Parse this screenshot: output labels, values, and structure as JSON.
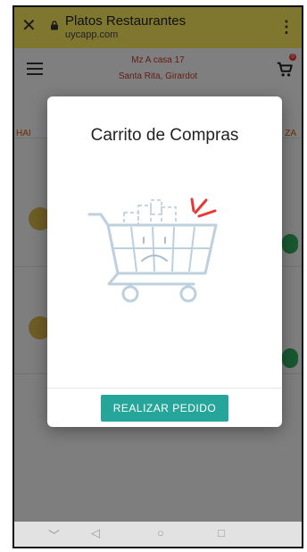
{
  "browser": {
    "title": "Platos Restaurantes",
    "url": "uycapp.com"
  },
  "header": {
    "address_line1": "Mz A casa 17",
    "address_line2": "Santa Rita, Girardot",
    "cart_count": "0"
  },
  "tabs": {
    "left_partial": "HAI",
    "right_partial": "ZA"
  },
  "dialog": {
    "title": "Carrito de Compras",
    "button_label": "REALIZAR PEDIDO",
    "illustration": "empty-cart-icon"
  },
  "colors": {
    "browser_bar": "#f3e35a",
    "address_text": "#c0392b",
    "accent_button": "#26a69a",
    "add_button": "#2eaa5c",
    "cart_line": "#bcd0de",
    "cart_accent": "#e53935"
  }
}
